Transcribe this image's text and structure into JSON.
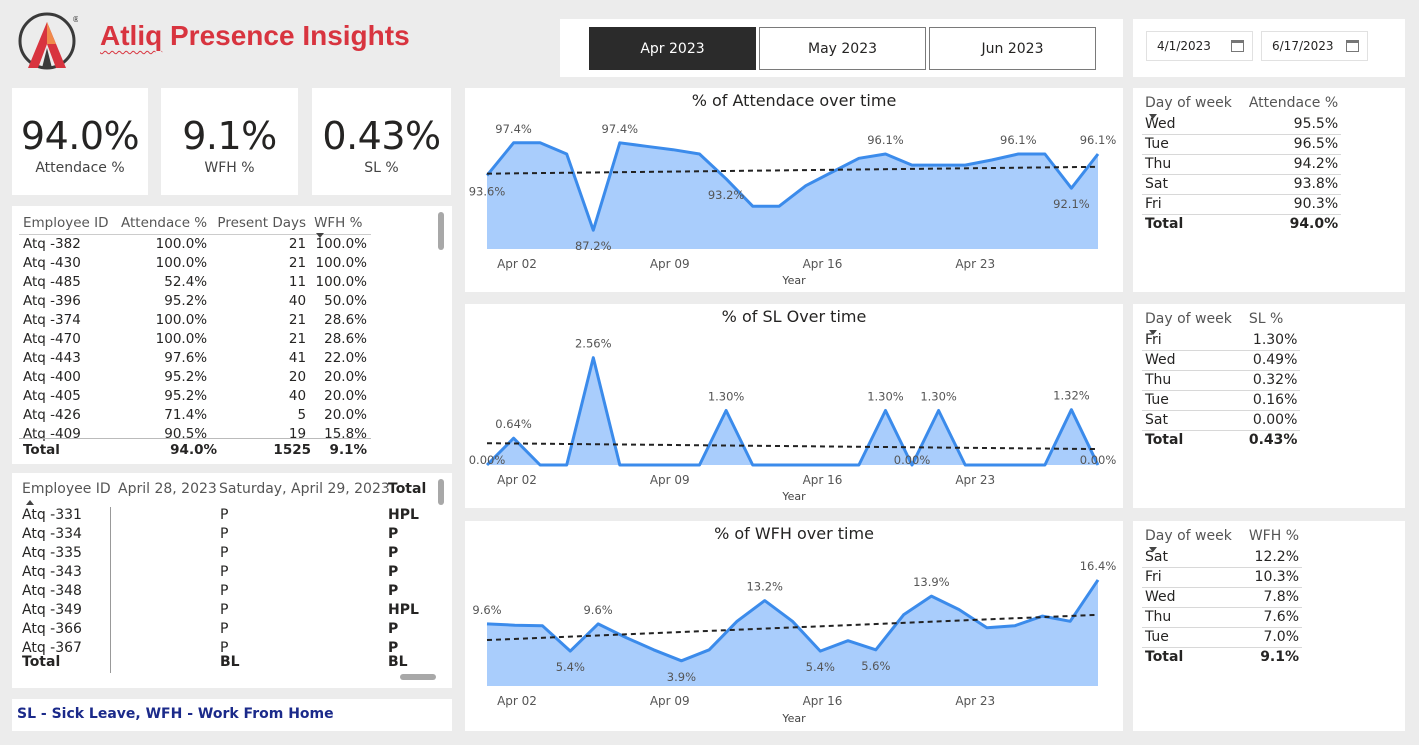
{
  "brand": {
    "title_part1": "Atliq",
    "title_part2": " Presence Insights"
  },
  "month_tabs": [
    {
      "label": "Apr 2023",
      "active": true
    },
    {
      "label": "May 2023",
      "active": false
    },
    {
      "label": "Jun 2023",
      "active": false
    }
  ],
  "date_range": {
    "start": "4/1/2023",
    "end": "6/17/2023"
  },
  "kpis": [
    {
      "value": "94.0%",
      "label": "Attendace %"
    },
    {
      "value": "9.1%",
      "label": "WFH %"
    },
    {
      "value": "0.43%",
      "label": "SL %"
    }
  ],
  "employee_table": {
    "headers": [
      "Employee ID",
      "Attendace %",
      "Present Days",
      "WFH %"
    ],
    "rows": [
      [
        "Atq -382",
        "100.0%",
        "21",
        "100.0%"
      ],
      [
        "Atq -430",
        "100.0%",
        "21",
        "100.0%"
      ],
      [
        "Atq -485",
        "52.4%",
        "11",
        "100.0%"
      ],
      [
        "Atq -396",
        "95.2%",
        "40",
        "50.0%"
      ],
      [
        "Atq -374",
        "100.0%",
        "21",
        "28.6%"
      ],
      [
        "Atq -470",
        "100.0%",
        "21",
        "28.6%"
      ],
      [
        "Atq -443",
        "97.6%",
        "41",
        "22.0%"
      ],
      [
        "Atq -400",
        "95.2%",
        "20",
        "20.0%"
      ],
      [
        "Atq -405",
        "95.2%",
        "40",
        "20.0%"
      ],
      [
        "Atq -426",
        "71.4%",
        "5",
        "20.0%"
      ],
      [
        "Atq -409",
        "90.5%",
        "19",
        "15.8%"
      ]
    ],
    "total": [
      "Total",
      "94.0%",
      "1525",
      "9.1%"
    ]
  },
  "status_matrix": {
    "headers": [
      "Employee ID",
      "April 28, 2023",
      "Saturday, April 29, 2023",
      "Total"
    ],
    "rows": [
      [
        "Atq -331",
        "P",
        "HPL"
      ],
      [
        "Atq -334",
        "P",
        "P"
      ],
      [
        "Atq -335",
        "P",
        "P"
      ],
      [
        "Atq -343",
        "P",
        "P"
      ],
      [
        "Atq -348",
        "P",
        "P"
      ],
      [
        "Atq -349",
        "P",
        "HPL"
      ],
      [
        "Atq -366",
        "P",
        "P"
      ],
      [
        "Atq -367",
        "P",
        "P"
      ]
    ],
    "total": [
      "Total",
      "BL",
      "BL"
    ]
  },
  "note": "SL - Sick Leave, WFH - Work From Home",
  "chart_data": [
    {
      "type": "area",
      "title": "% of Attendace over time",
      "xlabel": "Year",
      "x_ticks": [
        "Apr 02",
        "Apr 09",
        "Apr 16",
        "Apr 23"
      ],
      "x": [
        "2023-04-03",
        "2023-04-06",
        "2023-04-07",
        "2023-04-08",
        "2023-04-10",
        "2023-04-11",
        "2023-04-12",
        "2023-04-13",
        "2023-04-14",
        "2023-04-15",
        "2023-04-17",
        "2023-04-18",
        "2023-04-19",
        "2023-04-20",
        "2023-04-21",
        "2023-04-22",
        "2023-04-24",
        "2023-04-25",
        "2023-04-26",
        "2023-04-27",
        "2023-04-28",
        "2023-04-29",
        "2023-04-30"
      ],
      "values": [
        93.6,
        97.4,
        97.4,
        96.1,
        87.2,
        97.4,
        97.0,
        96.6,
        96.1,
        93.2,
        90.0,
        90.0,
        92.4,
        94.0,
        95.6,
        96.1,
        94.8,
        94.8,
        94.8,
        95.4,
        96.1,
        96.1,
        92.1,
        96.1
      ],
      "data_labels": [
        {
          "index": 0,
          "text": "93.6%"
        },
        {
          "index": 1,
          "text": "97.4%"
        },
        {
          "index": 4,
          "text": "87.2%"
        },
        {
          "index": 5,
          "text": "97.4%"
        },
        {
          "index": 9,
          "text": "93.2%"
        },
        {
          "index": 15,
          "text": "96.1%"
        },
        {
          "index": 20,
          "text": "96.1%"
        },
        {
          "index": 22,
          "text": "92.1%"
        },
        {
          "index": 23,
          "text": "96.1%"
        }
      ],
      "ylim": [
        85.0,
        98.2
      ],
      "trend": [
        93.8,
        94.6
      ]
    },
    {
      "type": "area",
      "title": "% of SL Over time",
      "xlabel": "Year",
      "x_ticks": [
        "Apr 02",
        "Apr 09",
        "Apr 16",
        "Apr 23"
      ],
      "values": [
        0.0,
        0.64,
        0.0,
        0.0,
        2.56,
        0.0,
        0.0,
        0.0,
        0.0,
        1.3,
        0.0,
        0.0,
        0.0,
        0.0,
        0.0,
        1.3,
        0.0,
        1.3,
        0.0,
        0.0,
        0.0,
        0.0,
        1.32,
        0.0
      ],
      "data_labels": [
        {
          "index": 0,
          "text": "0.00%"
        },
        {
          "index": 1,
          "text": "0.64%"
        },
        {
          "index": 4,
          "text": "2.56%"
        },
        {
          "index": 9,
          "text": "1.30%"
        },
        {
          "index": 15,
          "text": "1.30%"
        },
        {
          "index": 16,
          "text": "0.00%"
        },
        {
          "index": 17,
          "text": "1.30%"
        },
        {
          "index": 22,
          "text": "1.32%"
        },
        {
          "index": 23,
          "text": "0.00%"
        }
      ],
      "ylim": [
        0,
        2.6
      ],
      "trend": [
        0.52,
        0.38
      ]
    },
    {
      "type": "area",
      "title": "% of WFH over time",
      "xlabel": "Year",
      "x_ticks": [
        "Apr 02",
        "Apr 09",
        "Apr 16",
        "Apr 23"
      ],
      "values": [
        9.6,
        9.4,
        9.3,
        5.4,
        9.6,
        7.5,
        5.6,
        3.9,
        5.6,
        10.0,
        13.2,
        10.0,
        5.4,
        7.0,
        5.6,
        11.0,
        13.9,
        11.8,
        9.0,
        9.3,
        10.8,
        10.0,
        16.4
      ],
      "data_labels": [
        {
          "index": 0,
          "text": "9.6%"
        },
        {
          "index": 3,
          "text": "5.4%"
        },
        {
          "index": 4,
          "text": "9.6%"
        },
        {
          "index": 7,
          "text": "3.9%"
        },
        {
          "index": 10,
          "text": "13.2%"
        },
        {
          "index": 12,
          "text": "5.4%"
        },
        {
          "index": 14,
          "text": "5.6%"
        },
        {
          "index": 16,
          "text": "13.9%"
        },
        {
          "index": 22,
          "text": "16.4%"
        }
      ],
      "ylim": [
        0,
        17
      ],
      "trend": [
        7.1,
        11.0
      ]
    }
  ],
  "dow_tables": [
    {
      "headers": [
        "Day of week",
        "Attendace %"
      ],
      "rows": [
        [
          "Wed",
          "95.5%"
        ],
        [
          "Tue",
          "96.5%"
        ],
        [
          "Thu",
          "94.2%"
        ],
        [
          "Sat",
          "93.8%"
        ],
        [
          "Fri",
          "90.3%"
        ]
      ],
      "total": [
        "Total",
        "94.0%"
      ]
    },
    {
      "headers": [
        "Day of week",
        "SL %"
      ],
      "rows": [
        [
          "Fri",
          "1.30%"
        ],
        [
          "Wed",
          "0.49%"
        ],
        [
          "Thu",
          "0.32%"
        ],
        [
          "Tue",
          "0.16%"
        ],
        [
          "Sat",
          "0.00%"
        ]
      ],
      "total": [
        "Total",
        "0.43%"
      ]
    },
    {
      "headers": [
        "Day of week",
        "WFH %"
      ],
      "rows": [
        [
          "Sat",
          "12.2%"
        ],
        [
          "Fri",
          "10.3%"
        ],
        [
          "Wed",
          "7.8%"
        ],
        [
          "Thu",
          "7.6%"
        ],
        [
          "Tue",
          "7.0%"
        ]
      ],
      "total": [
        "Total",
        "9.1%"
      ]
    }
  ],
  "colors": {
    "brand_red": "#d8343f",
    "line_blue": "#3b8beb",
    "area_blue": "#a9cdfc",
    "note_navy": "#1b2a8a",
    "tab_active": "#2b2b2b"
  }
}
